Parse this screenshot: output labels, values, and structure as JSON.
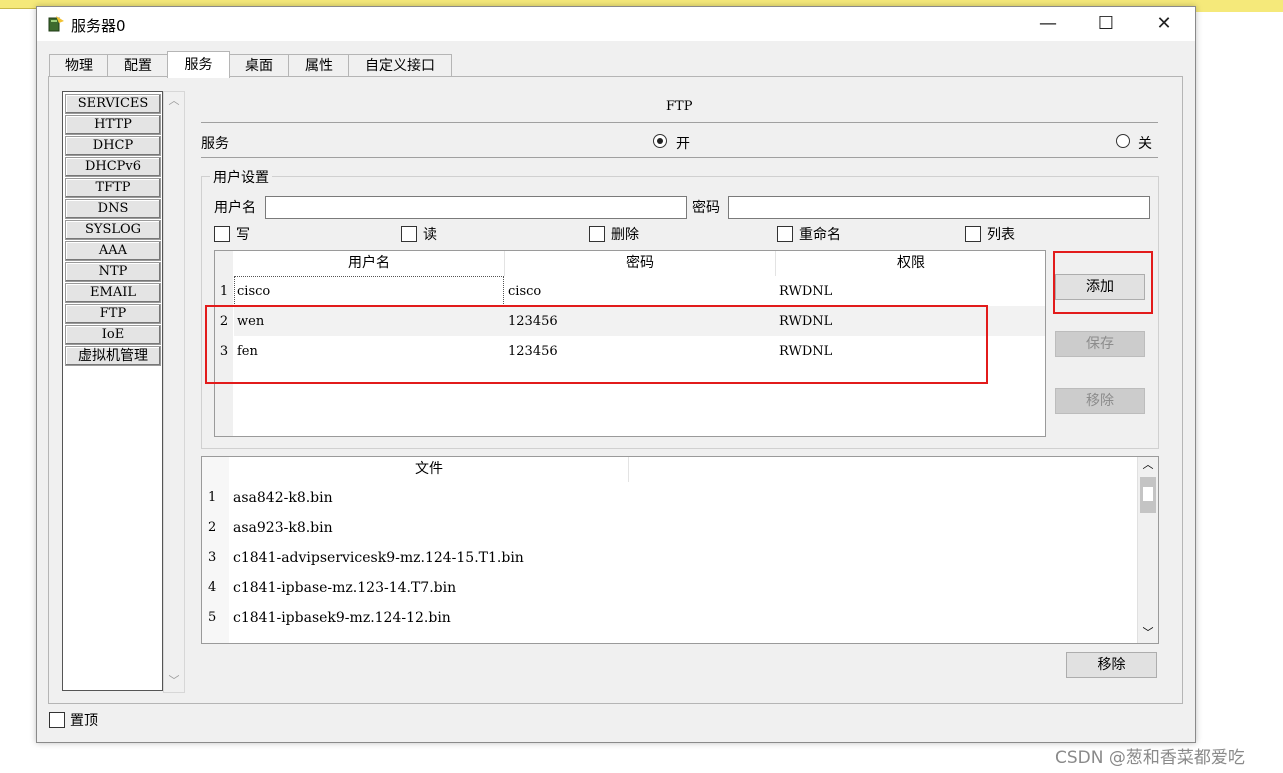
{
  "window": {
    "title": "服务器0",
    "minimize": "—",
    "maximize": "☐",
    "close": "✕"
  },
  "tabs": [
    "物理",
    "配置",
    "服务",
    "桌面",
    "属性",
    "自定义接口"
  ],
  "services": [
    "SERVICES",
    "HTTP",
    "DHCP",
    "DHCPv6",
    "TFTP",
    "DNS",
    "SYSLOG",
    "AAA",
    "NTP",
    "EMAIL",
    "FTP",
    "IoE",
    "虚拟机管理"
  ],
  "ftp": {
    "title": "FTP",
    "service_label": "服务",
    "on_label": "开",
    "off_label": "关",
    "service_state": "on",
    "user_settings": {
      "legend": "用户设置",
      "username_label": "用户名",
      "username_value": "",
      "password_label": "密码",
      "password_value": "",
      "permissions": [
        {
          "label": "写",
          "checked": false
        },
        {
          "label": "读",
          "checked": false
        },
        {
          "label": "删除",
          "checked": false
        },
        {
          "label": "重命名",
          "checked": false
        },
        {
          "label": "列表",
          "checked": false
        }
      ],
      "columns": [
        "用户名",
        "密码",
        "权限"
      ],
      "rows": [
        {
          "num": "1",
          "user": "cisco",
          "password": "cisco",
          "perm": "RWDNL"
        },
        {
          "num": "2",
          "user": "wen",
          "password": "123456",
          "perm": "RWDNL"
        },
        {
          "num": "3",
          "user": "fen",
          "password": "123456",
          "perm": "RWDNL"
        }
      ],
      "add_button": "添加",
      "save_button": "保存",
      "remove_button": "移除"
    },
    "files": {
      "column": "文件",
      "rows": [
        {
          "num": "1",
          "name": "asa842-k8.bin"
        },
        {
          "num": "2",
          "name": "asa923-k8.bin"
        },
        {
          "num": "3",
          "name": "c1841-advipservicesk9-mz.124-15.T1.bin"
        },
        {
          "num": "4",
          "name": "c1841-ipbase-mz.123-14.T7.bin"
        },
        {
          "num": "5",
          "name": "c1841-ipbasek9-mz.124-12.bin"
        }
      ],
      "remove_button": "移除"
    }
  },
  "always_on_top": {
    "label": "置顶",
    "checked": false
  },
  "watermark": "CSDN @葱和香菜都爱吃",
  "colors": {
    "highlight": "#e21b1b"
  }
}
